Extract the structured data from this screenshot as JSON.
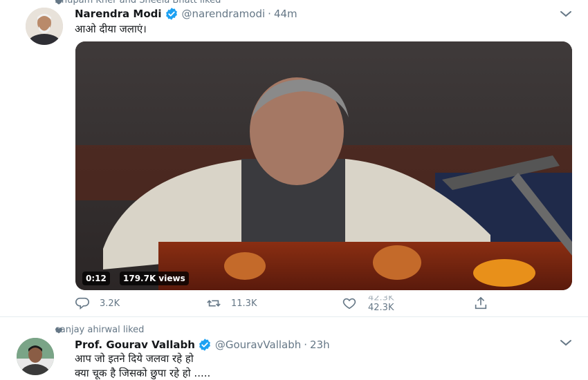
{
  "tweets": [
    {
      "social_context": "Anupam Kher and Sheela Bhatt liked",
      "author": {
        "name": "Narendra Modi",
        "handle": "@narendramodi",
        "time": "44m"
      },
      "separator": "·",
      "text": "आओ दीया जलाएं।",
      "media": {
        "duration": "0:12",
        "views": "179.7K views"
      },
      "actions": {
        "replies": "3.2K",
        "retweets": "11.3K",
        "likes": "42.3K",
        "likes_ghost": "42.3K"
      },
      "icons": [
        "heart-icon",
        "verified-badge-icon",
        "chevron-down-icon",
        "reply-icon",
        "retweet-icon",
        "like-icon",
        "share-icon"
      ]
    },
    {
      "social_context": "sanjay ahirwal liked",
      "author": {
        "name": "Prof. Gourav Vallabh",
        "handle": "@GouravVallabh",
        "time": "23h"
      },
      "separator": "·",
      "text": "आप जो इतने दिये जलवा रहे हो\nक्या चूक है जिसको छुपा रहे हो ....."
    }
  ],
  "colors": {
    "text_primary": "#14171a",
    "text_secondary": "#657786",
    "verified_blue": "#1da1f2",
    "divider": "#e6ecf0"
  }
}
